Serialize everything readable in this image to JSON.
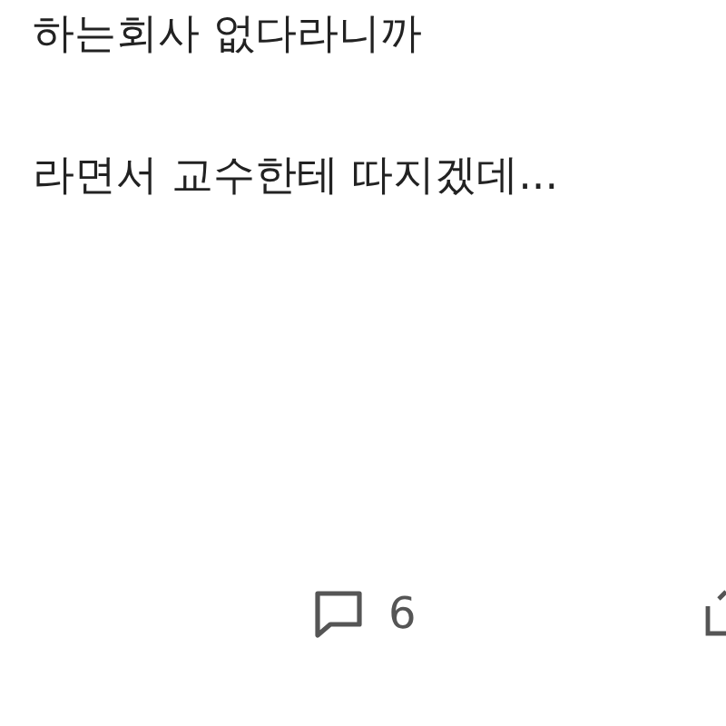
{
  "post": {
    "lines": [
      "하는회사 없다라니까",
      "라면서 교수한테 따지겠데..."
    ]
  },
  "actions": {
    "comment_count": "6"
  }
}
